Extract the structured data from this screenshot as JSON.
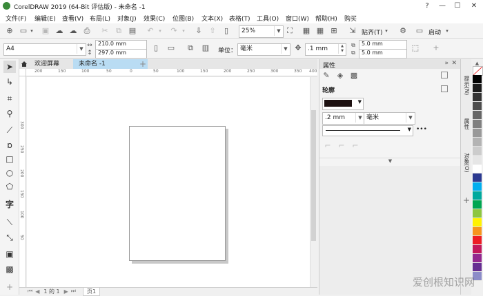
{
  "window": {
    "title": "CorelDRAW 2019 (64-Bit 评估版) - 未命名 -1",
    "controls": [
      "?",
      "—",
      "☐",
      "✕"
    ]
  },
  "menu": [
    "文件(F)",
    "编辑(E)",
    "查看(V)",
    "布局(L)",
    "对象(J)",
    "效果(C)",
    "位图(B)",
    "文本(X)",
    "表格(T)",
    "工具(O)",
    "窗口(W)",
    "帮助(H)",
    "购买"
  ],
  "toolbar": {
    "zoom": "25%",
    "snap_label": "贴齐(T)",
    "launch_label": "启动"
  },
  "propbar": {
    "page_size": "A4",
    "width": "210.0 mm",
    "height": "297.0 mm",
    "units_label": "单位：",
    "units": "毫米",
    "nudge": ".1 mm",
    "dup_x": "5.0 mm",
    "dup_y": "5.0 mm"
  },
  "tabs": {
    "welcome": "欢迎屏幕",
    "document": "未命名 -1",
    "add": "+"
  },
  "ruler": {
    "top": [
      "200",
      "150",
      "100",
      "50",
      "0",
      "50",
      "100",
      "150",
      "200",
      "250",
      "300",
      "350",
      "400"
    ],
    "left": [
      "300",
      "250",
      "200",
      "150",
      "100",
      "50"
    ]
  },
  "statusbar": {
    "page_counter": "1 的 1",
    "page_tab": "页1"
  },
  "docker": {
    "title": "属性",
    "section": "轮廓",
    "outline_width": ".2 mm",
    "outline_units": "毫米",
    "more": "•••"
  },
  "side_tabs": [
    "提示(N)",
    "属性",
    "对象(O)"
  ],
  "palette": [
    "#ffffff",
    "#000000",
    "#1a1a1a",
    "#333333",
    "#4d4d4d",
    "#666666",
    "#808080",
    "#999999",
    "#b3b3b3",
    "#cccccc",
    "#e6e6e6",
    "#ffffff",
    "#2b3990",
    "#00aeef",
    "#00a99d",
    "#00a651",
    "#8dc63f",
    "#fff200",
    "#f7941d",
    "#ed1c24",
    "#c2185b",
    "#92278f",
    "#662d91",
    "#8c8cc8"
  ],
  "watermark": "爱创根知识网"
}
